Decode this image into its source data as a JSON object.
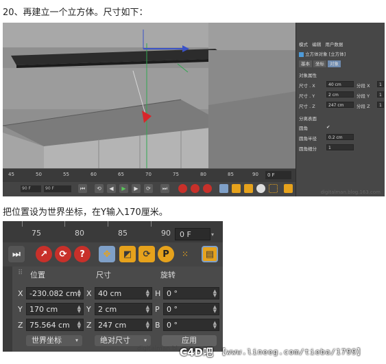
{
  "captions": {
    "step20": "20、再建立一个立方体。尺寸如下：",
    "instruction": "把位置设为世界坐标，在Y输入170厘米。"
  },
  "shot1": {
    "timeline_ticks": [
      "45",
      "50",
      "55",
      "60",
      "65",
      "70",
      "75",
      "80",
      "85",
      "90"
    ],
    "frame_value": "0 F",
    "left_frame_a": "90 F",
    "left_frame_b": "90 F",
    "watermark": "digitalman.blog.163.com",
    "panel": {
      "menu": [
        "模式",
        "编辑",
        "用户数据"
      ],
      "object_title": "立方体对象 [立方体]",
      "tabs": [
        "基本",
        "坐标",
        "对象"
      ],
      "section": "对象属性",
      "size_x_label": "尺寸 . X",
      "size_x": "40 cm",
      "size_y_label": "尺寸 . Y",
      "size_y": "2 cm",
      "size_z_label": "尺寸 . Z",
      "size_z": "247 cm",
      "seg_x_label": "分段 X",
      "seg_x": "1",
      "seg_y_label": "分段 Y",
      "seg_y": "1",
      "seg_z_label": "分段 Z",
      "seg_z": "1",
      "separate_surfaces": "分离表面",
      "fillet": "圆角",
      "fillet_check": "✔",
      "fillet_radius_label": "圆角半径",
      "fillet_radius": "0.2 cm",
      "fillet_subdiv_label": "圆角细分",
      "fillet_subdiv": "1"
    }
  },
  "shot2": {
    "ruler_ticks": [
      "75",
      "80",
      "85",
      "90"
    ],
    "frame_value": "0 F",
    "headers": {
      "position": "位置",
      "size": "尺寸",
      "rotation": "旋转"
    },
    "rows": [
      {
        "pos_axis": "X",
        "pos": "-230.082 cm",
        "size_axis": "X",
        "size": "40 cm",
        "rot_axis": "H",
        "rot": "0 °"
      },
      {
        "pos_axis": "Y",
        "pos": "170 cm",
        "size_axis": "Y",
        "size": "2 cm",
        "rot_axis": "P",
        "rot": "0 °"
      },
      {
        "pos_axis": "Z",
        "pos": "75.564 cm",
        "size_axis": "Z",
        "size": "247 cm",
        "rot_axis": "B",
        "rot": "0 °"
      }
    ],
    "coord_mode": "世界坐标",
    "size_mode": "绝对尺寸",
    "apply": "应用",
    "watermark_small": "digitalman.bl",
    "watermark_logo": "C4D吧",
    "watermark_url": "【www.lineeg.com/tieba/1799】"
  },
  "colors": {
    "accent_orange": "#e6a21c",
    "accent_red": "#c8302a",
    "selection_blue": "#6e8bb0"
  }
}
